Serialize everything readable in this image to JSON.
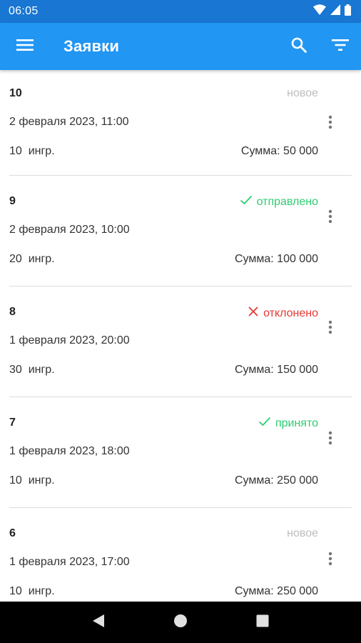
{
  "status_bar": {
    "time": "06:05"
  },
  "app_bar": {
    "title": "Заявки"
  },
  "orders": [
    {
      "id": "10",
      "status": "новое",
      "status_type": "new",
      "date": "2 февраля 2023, 11:00",
      "ingredients": "10  ингр.",
      "sum": "Сумма: 50 000"
    },
    {
      "id": "9",
      "status": "отправлено",
      "status_type": "sent",
      "date": "2 февраля 2023, 10:00",
      "ingredients": "20  ингр.",
      "sum": "Сумма: 100 000"
    },
    {
      "id": "8",
      "status": "отклонено",
      "status_type": "rejected",
      "date": "1 февраля 2023, 20:00",
      "ingredients": "30  ингр.",
      "sum": "Сумма: 150 000"
    },
    {
      "id": "7",
      "status": "принято",
      "status_type": "accepted",
      "date": "1 февраля 2023, 18:00",
      "ingredients": "10  ингр.",
      "sum": "Сумма: 250 000"
    },
    {
      "id": "6",
      "status": "новое",
      "status_type": "new",
      "date": "1 февраля 2023, 17:00",
      "ingredients": "10  ингр.",
      "sum": "Сумма: 250 000"
    }
  ],
  "colors": {
    "app_bar": "#2196f3",
    "status_bar": "#1976d2",
    "status_new": "#bdbdbd",
    "status_sent": "#2ecc71",
    "status_rejected": "#e53935",
    "status_accepted": "#2ecc71"
  },
  "icons": {
    "menu": "menu-icon",
    "search": "search-icon",
    "filter": "filter-icon",
    "more": "more-vert-icon",
    "check": "check-icon",
    "close": "close-icon"
  }
}
